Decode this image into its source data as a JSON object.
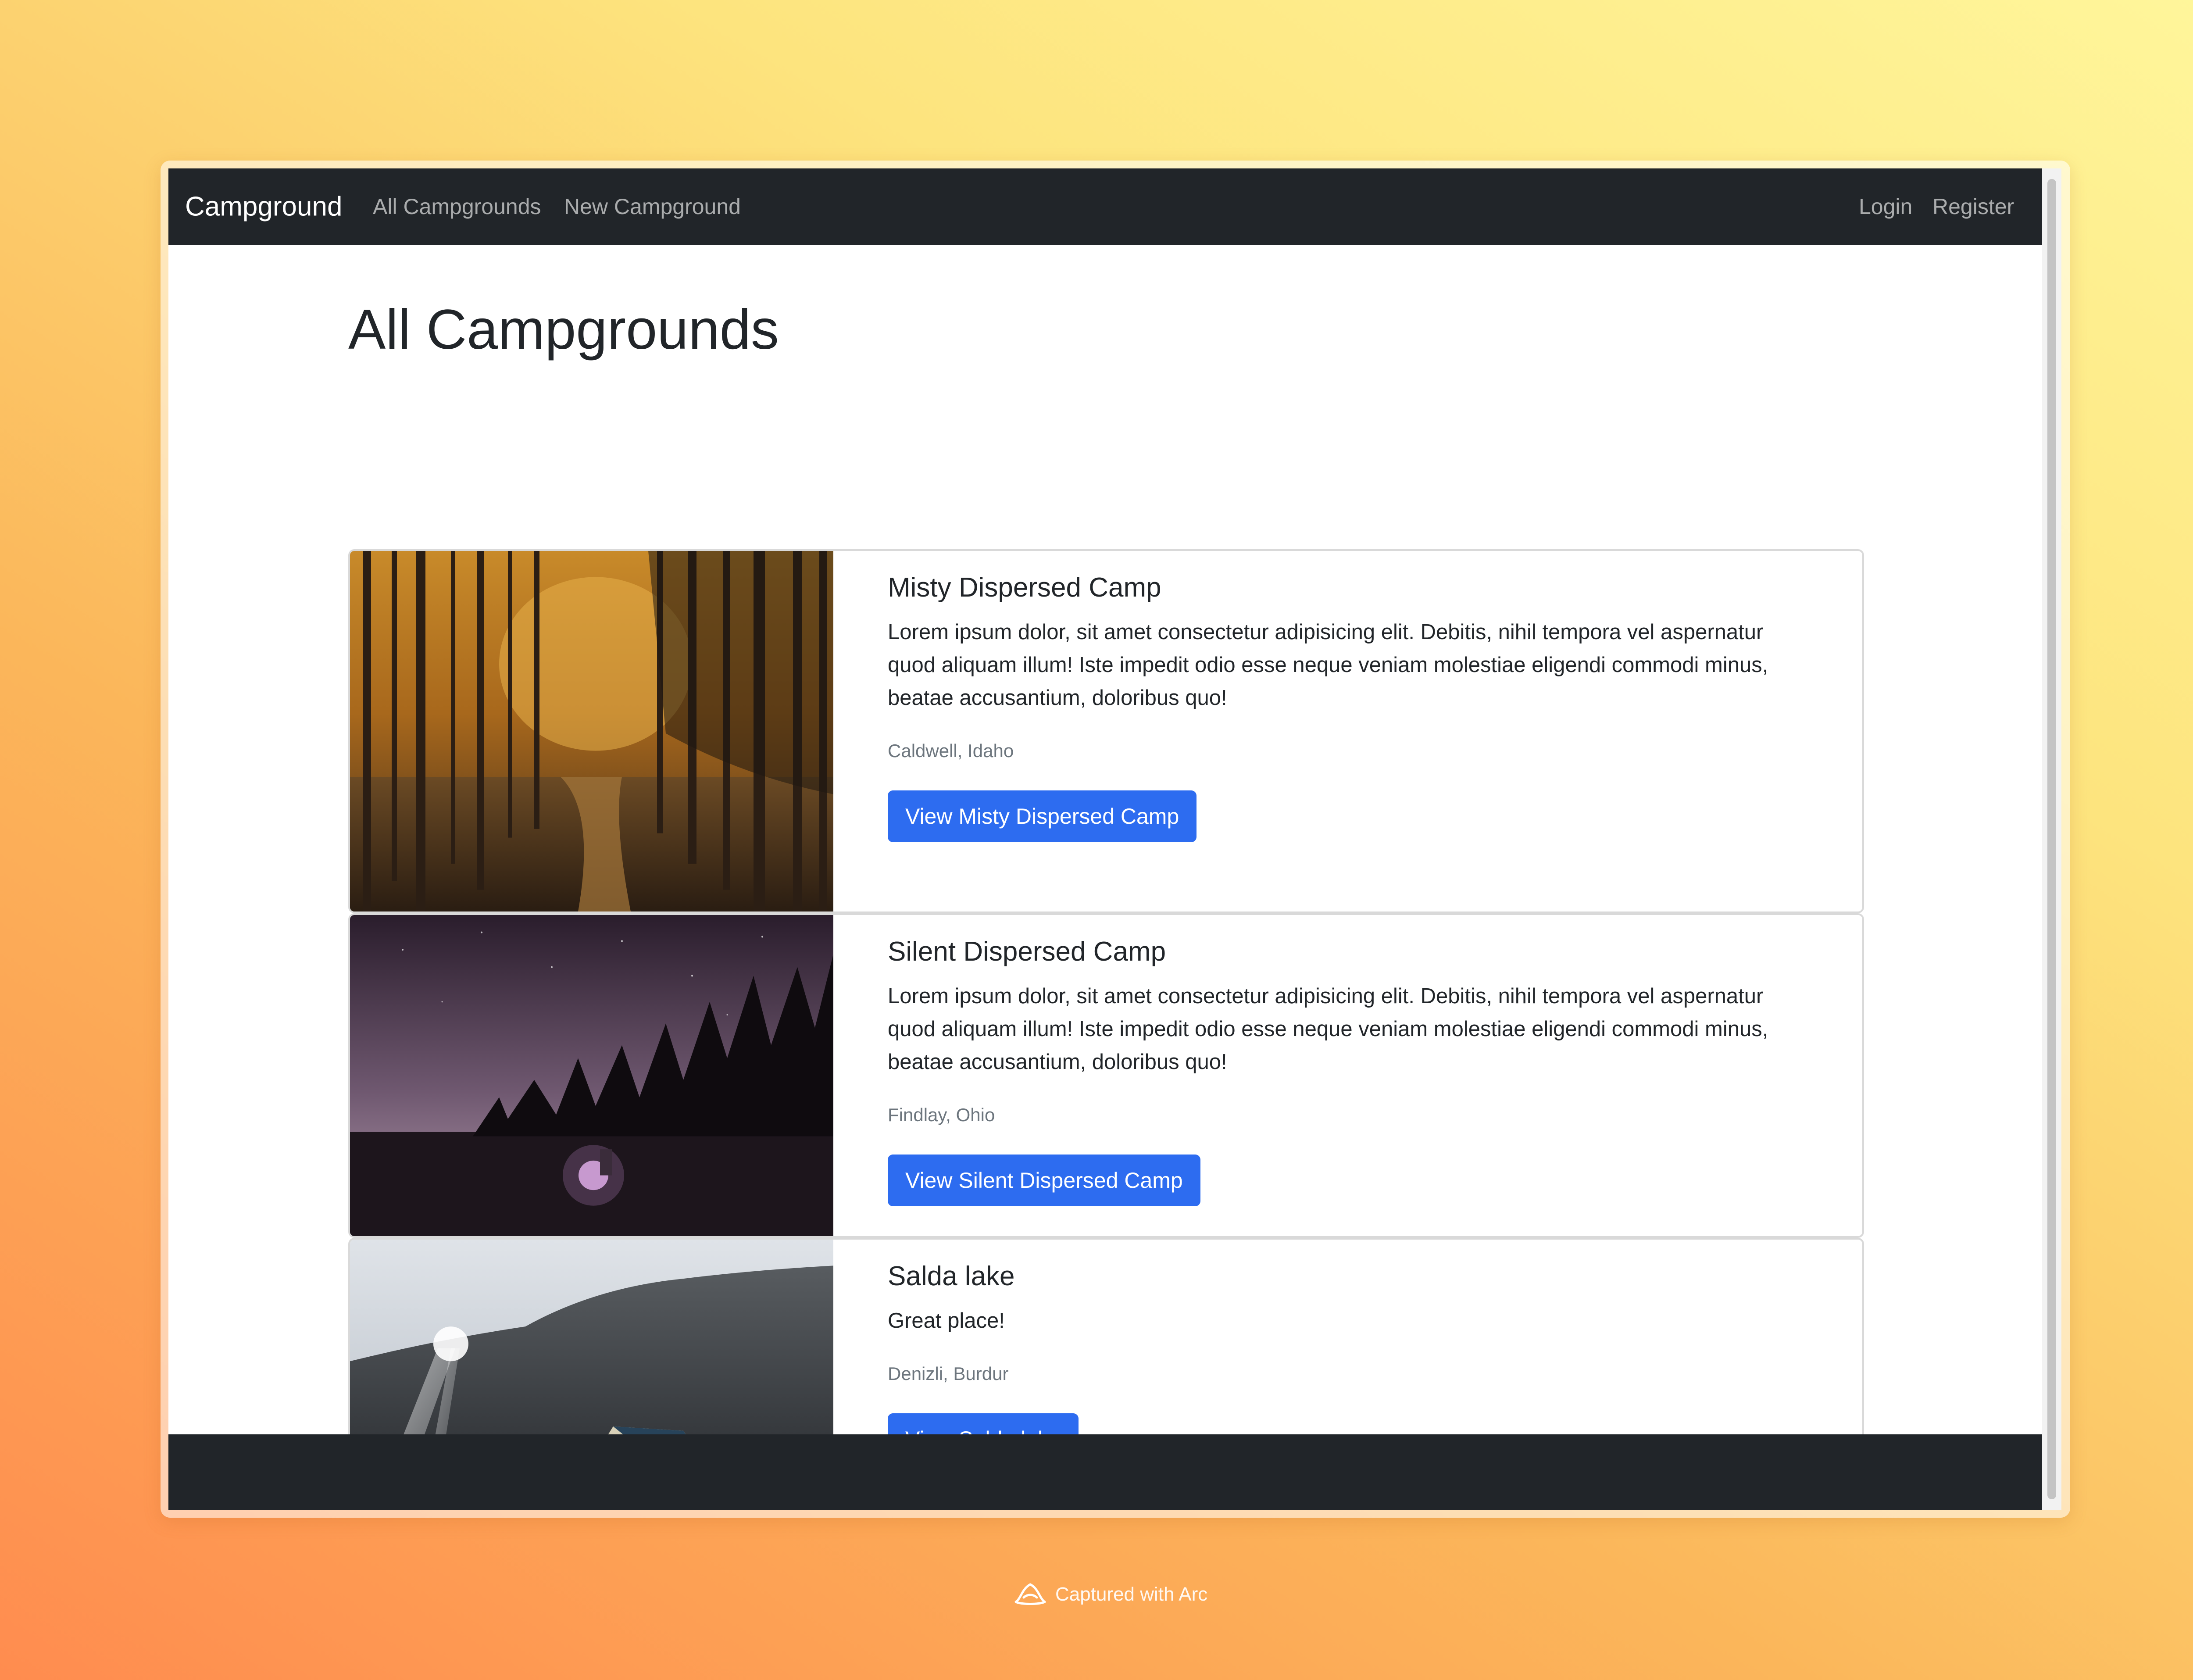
{
  "navbar": {
    "brand": "Campground",
    "links": [
      "All Campgrounds",
      "New Campground"
    ],
    "auth_links": [
      "Login",
      "Register"
    ]
  },
  "page": {
    "title": "All Campgrounds"
  },
  "campgrounds": [
    {
      "title": "Misty Dispersed Camp",
      "description": "Lorem ipsum dolor, sit amet consectetur adipisicing elit. Debitis, nihil tempora vel aspernatur quod aliquam illum! Iste impedit odio esse neque veniam molestiae eligendi commodi minus, beatae accusantium, doloribus quo!",
      "location": "Caldwell, Idaho",
      "button_label": "View Misty Dispersed Camp",
      "image_icon": "forest-autumn-photo"
    },
    {
      "title": "Silent Dispersed Camp",
      "description": "Lorem ipsum dolor, sit amet consectetur adipisicing elit. Debitis, nihil tempora vel aspernatur quod aliquam illum! Iste impedit odio esse neque veniam molestiae eligendi commodi minus, beatae accusantium, doloribus quo!",
      "location": "Findlay, Ohio",
      "button_label": "View Silent Dispersed Camp",
      "image_icon": "night-campfire-photo"
    },
    {
      "title": "Salda lake",
      "description": "Great place!",
      "location": "Denizli, Burdur",
      "button_label": "View Salda lake",
      "image_icon": "mountain-tent-photo"
    }
  ],
  "watermark": {
    "text": "Captured with Arc",
    "icon": "arc-logo-icon"
  },
  "colors": {
    "navbar": "#212529",
    "button": "#2d6cf0",
    "muted_text": "#6c757d"
  }
}
